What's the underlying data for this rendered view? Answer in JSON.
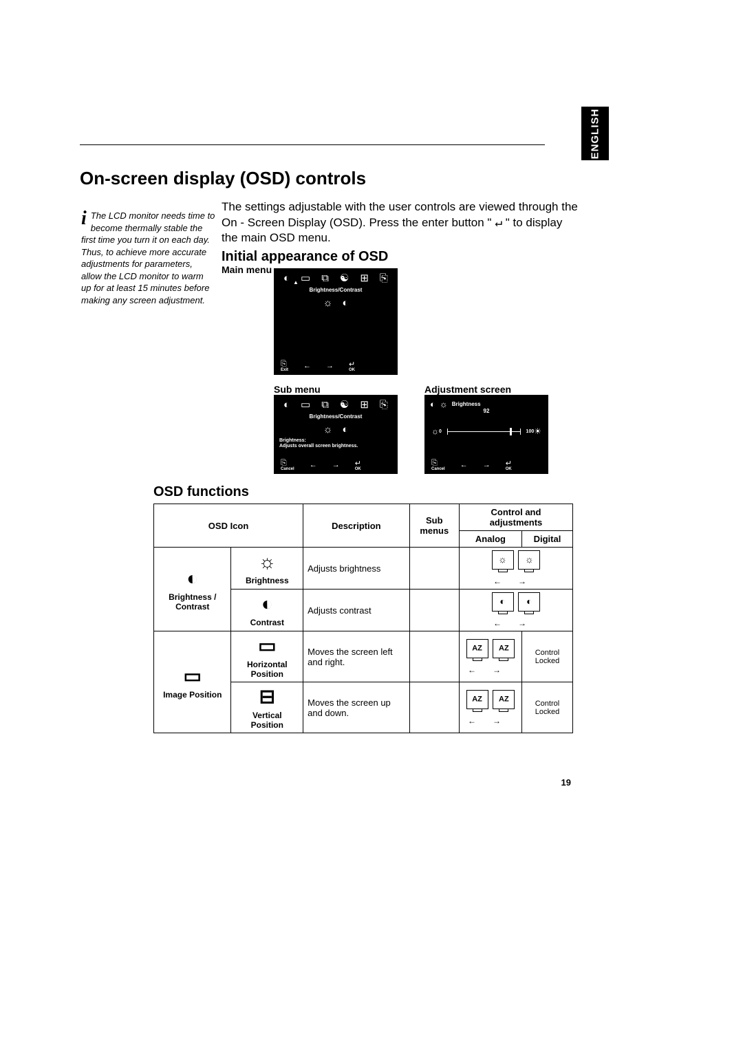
{
  "lang_tab": "ENGLISH",
  "title": "On-screen display (OSD) controls",
  "sidebar_note": "The LCD monitor needs time to become thermally stable the first time you turn it on each day. Thus, to achieve more accurate adjustments for parameters, allow the LCD monitor to warm up for  at least 15 minutes before making any screen adjustment.",
  "intro_before": "The settings adjustable with the user controls are viewed through the On - Screen Display (OSD). Press the enter button \" ",
  "enter_symbol": "↵",
  "intro_after": " \" to display the main OSD menu.",
  "h2_initial": "Initial appearance of OSD",
  "labels": {
    "main_menu": "Main menu",
    "sub_menu": "Sub menu",
    "adjustment_screen": "Adjustment screen"
  },
  "osd": {
    "section_title": "Brightness/Contrast",
    "desc_line1": "Brightness:",
    "desc_line2": "Adjusts overall screen brightness.",
    "exit": "Exit",
    "cancel": "Cancel",
    "ok": "OK",
    "adj_label": "Brightness",
    "adj_value": "92",
    "adj_min": "0",
    "adj_max": "100"
  },
  "h2_functions": "OSD functions",
  "table": {
    "headers": {
      "icon": "OSD Icon",
      "description": "Description",
      "submenus": "Sub menus",
      "controls": "Control and adjustments",
      "analog": "Analog",
      "digital": "Digital"
    },
    "rows": {
      "bc_group": "Brightness / Contrast",
      "brightness": {
        "name": "Brightness",
        "desc": "Adjusts brightness"
      },
      "contrast": {
        "name": "Contrast",
        "desc": "Adjusts contrast"
      },
      "ip_group": "Image Position",
      "hpos": {
        "name": "Horizontal Position",
        "desc": "Moves the screen left and right."
      },
      "vpos": {
        "name": "Vertical Position",
        "desc": "Moves the screen up and down."
      },
      "locked": "Control Locked"
    }
  },
  "page_number": "19"
}
